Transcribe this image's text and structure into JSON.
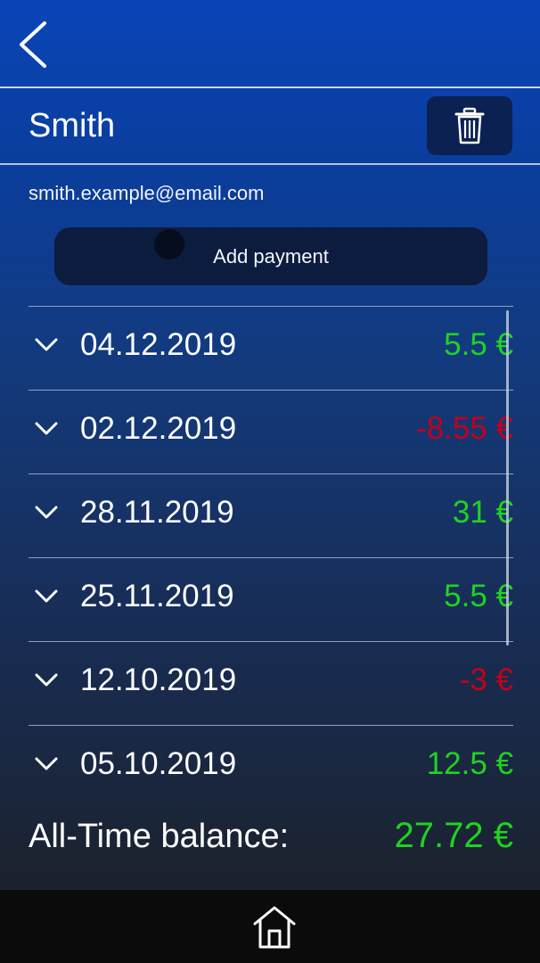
{
  "contact": {
    "name": "Smith",
    "email": "smith.example@email.com"
  },
  "actions": {
    "add_payment_label": "Add payment"
  },
  "icons": {
    "back": "chevron-left-icon",
    "trash": "trash-icon",
    "expand": "chevron-down-icon",
    "home": "home-icon"
  },
  "colors": {
    "positive": "#1fd31f",
    "negative": "#c4001a",
    "accent": "#0a45b8"
  },
  "payments": [
    {
      "date": "04.12.2019",
      "amount": "5.5 €",
      "sign": "pos"
    },
    {
      "date": "02.12.2019",
      "amount": "-8.55 €",
      "sign": "neg"
    },
    {
      "date": "28.11.2019",
      "amount": "31 €",
      "sign": "pos"
    },
    {
      "date": "25.11.2019",
      "amount": "5.5 €",
      "sign": "pos"
    },
    {
      "date": "12.10.2019",
      "amount": "-3 €",
      "sign": "neg"
    },
    {
      "date": "05.10.2019",
      "amount": "12.5 €",
      "sign": "pos"
    }
  ],
  "balance": {
    "label": "All-Time balance:",
    "value": "27.72 €"
  }
}
